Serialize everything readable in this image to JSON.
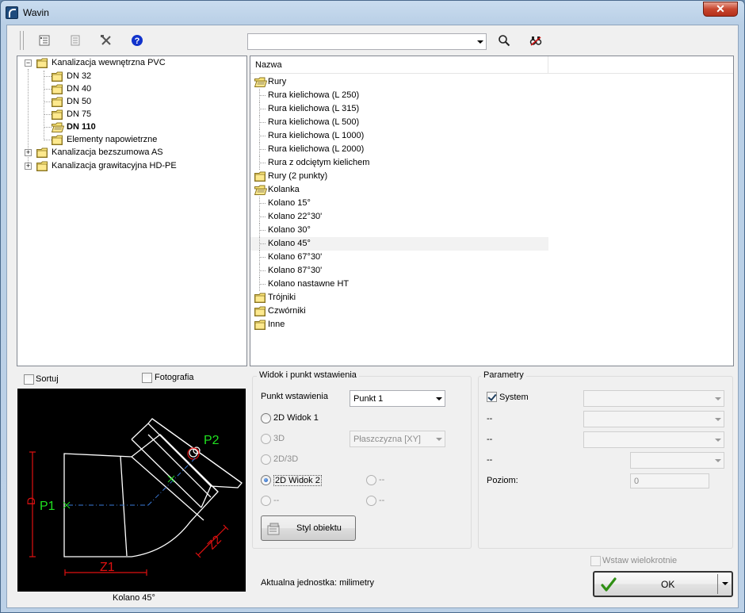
{
  "window": {
    "title": "Wavin",
    "close_glyph": "✕"
  },
  "toolbar": {
    "icons": [
      "properties-icon",
      "list-icon",
      "tools-icon",
      "help-icon"
    ],
    "search_value": "",
    "search_icon": "magnifier-icon",
    "find_icon": "binoculars-icon"
  },
  "tree": {
    "root1": {
      "label": "Kanalizacja wewnętrzna PVC",
      "expander": "−"
    },
    "children": [
      {
        "label": "DN 32"
      },
      {
        "label": "DN 40"
      },
      {
        "label": "DN 50"
      },
      {
        "label": "DN 75"
      },
      {
        "label": "DN 110"
      },
      {
        "label": "Elementy napowietrzne"
      }
    ],
    "root2": {
      "label": "Kanalizacja bezszumowa AS",
      "expander": "+"
    },
    "root3": {
      "label": "Kanalizacja grawitacyjna HD-PE",
      "expander": "+"
    }
  },
  "list": {
    "header": "Nazwa",
    "rows": [
      {
        "label": "Rury",
        "type": "folder-open"
      },
      {
        "label": "Rura kielichowa (L 250)",
        "type": "item"
      },
      {
        "label": "Rura kielichowa (L 315)",
        "type": "item"
      },
      {
        "label": "Rura kielichowa (L 500)",
        "type": "item"
      },
      {
        "label": "Rura kielichowa (L 1000)",
        "type": "item"
      },
      {
        "label": "Rura kielichowa (L 2000)",
        "type": "item"
      },
      {
        "label": "Rura z odciętym kielichem",
        "type": "item"
      },
      {
        "label": "Rury (2 punkty)",
        "type": "folder"
      },
      {
        "label": "Kolanka",
        "type": "folder-open"
      },
      {
        "label": "Kolano 15°",
        "type": "item"
      },
      {
        "label": "Kolano 22°30'",
        "type": "item"
      },
      {
        "label": "Kolano 30°",
        "type": "item"
      },
      {
        "label": "Kolano 45°",
        "type": "item",
        "highlight": true
      },
      {
        "label": "Kolano 67°30'",
        "type": "item"
      },
      {
        "label": "Kolano 87°30'",
        "type": "item"
      },
      {
        "label": "Kolano nastawne HT",
        "type": "item"
      },
      {
        "label": "Trójniki",
        "type": "folder"
      },
      {
        "label": "Czwórniki",
        "type": "folder"
      },
      {
        "label": "Inne",
        "type": "folder"
      }
    ]
  },
  "preview": {
    "sortuj": "Sortuj",
    "fotografia": "Fotografia",
    "caption": "Kolano 45°",
    "labels": {
      "p1": "P1",
      "p2": "P2",
      "d": "D",
      "z1": "Z1",
      "z2": "Z2"
    },
    "colors": {
      "outline": "#ffffff",
      "dimension": "#e01010",
      "point": "#20e020",
      "axis": "#3a7ad8"
    }
  },
  "view": {
    "title": "Widok i punkt wstawienia",
    "insert_label": "Punkt wstawienia",
    "insert_value": "Punkt 1",
    "radio_2d1": "2D Widok 1",
    "radio_3d": "3D",
    "plane_value": "Płaszczyzna  [XY]",
    "radio_2d3d": "2D/3D",
    "radio_2d2": "2D Widok 2",
    "radio_dash": "--",
    "style_button": "Styl obiektu"
  },
  "params": {
    "title": "Parametry",
    "system_label": "System",
    "row2": "--",
    "row3": "--",
    "row4": "--",
    "level_label": "Poziom:",
    "level_value": "0"
  },
  "footer": {
    "unit": "Aktualna jednostka: milimetry",
    "insert_multi": "Wstaw wielokrotnie",
    "ok": "OK"
  }
}
